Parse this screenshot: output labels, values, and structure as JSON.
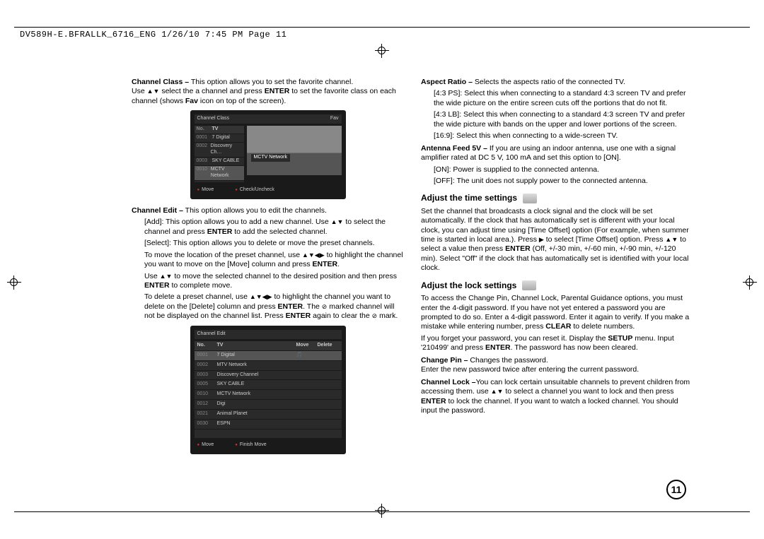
{
  "header": "DV589H-E.BFRALLK_6716_ENG  1/26/10  7:45 PM  Page 11",
  "page_number": "11",
  "left": {
    "channel_class_label": "Channel Class –",
    "channel_class_text": " This option allows you to set the favorite channel.",
    "channel_class_line2a": "Use ",
    "channel_class_line2b": " select the a channel and press ",
    "channel_class_enter": "ENTER",
    "channel_class_line2c": " to set the favorite class on each channel (shows ",
    "channel_class_fav": "Fav",
    "channel_class_line2d": " icon on top of the screen).",
    "shot1": {
      "title_left": "Channel Class",
      "title_right": "Fav",
      "col_no": "No.",
      "col_tv": "TV",
      "rows": [
        {
          "no": "0001",
          "name": "7 Digital"
        },
        {
          "no": "0002",
          "name": "Discovery Ch…"
        },
        {
          "no": "0003",
          "name": "SKY CABLE"
        },
        {
          "no": "0010",
          "name": "MCTV Network"
        }
      ],
      "preview_label": "MCTV Network",
      "foot_left": "Move",
      "foot_right": "Check/Uncheck"
    },
    "channel_edit_label": "Channel Edit –",
    "channel_edit_text": " This option allows you to edit the channels.",
    "add_line_a": "[Add]: This option allows you to add a new channel. Use ",
    "add_line_b": " to select the channel and press ",
    "add_line_c": " to add the selected channel.",
    "select_line": "[Select]: This option allows you to delete or move the preset channels.",
    "move_line_a": "To move the location of the preset channel, use ",
    "move_line_b": " to highlight the channel you want to move on the [Move] column and press ",
    "move_line_c": ".",
    "use_line_a": "Use ",
    "use_line_b": " to move the selected channel to the desired position and then press ",
    "use_line_c": " to complete move.",
    "delete_line_a": "To delete a preset channel, use ",
    "delete_line_b": " to highlight the channel you want to delete on the [Delete] column and press ",
    "delete_line_c": ". The ",
    "delete_line_d": " marked channel will not be displayed on the channel list. Press ",
    "delete_line_e": " again to clear the ",
    "delete_line_f": " mark.",
    "shot2": {
      "title": "Channel Edit",
      "h_no": "No.",
      "h_tv": "TV",
      "h_move": "Move",
      "h_del": "Delete",
      "rows": [
        {
          "no": "0001",
          "name": "7 Digital",
          "move": "🎵",
          "del": ""
        },
        {
          "no": "0002",
          "name": "MTV Network",
          "move": "",
          "del": ""
        },
        {
          "no": "0003",
          "name": "Discovery Channel",
          "move": "",
          "del": ""
        },
        {
          "no": "0005",
          "name": "SKY CABLE",
          "move": "",
          "del": ""
        },
        {
          "no": "0010",
          "name": "MCTV Network",
          "move": "",
          "del": ""
        },
        {
          "no": "0012",
          "name": "Digi",
          "move": "",
          "del": ""
        },
        {
          "no": "0021",
          "name": "Animal Planet",
          "move": "",
          "del": ""
        },
        {
          "no": "0030",
          "name": "ESPN",
          "move": "",
          "del": ""
        },
        {
          "no": "",
          "name": "",
          "move": "",
          "del": ""
        }
      ],
      "foot_left": "Move",
      "foot_right": "Finish Move"
    }
  },
  "right": {
    "aspect_label": "Aspect Ratio –",
    "aspect_text": " Selects the aspects ratio of the connected TV.",
    "ar_43ps": "[4:3 PS]: Select this when connecting to a standard 4:3 screen TV and prefer the wide picture on the entire screen cuts off the portions that do not fit.",
    "ar_43lb": "[4:3 LB]: Select this when connecting to a standard 4:3 screen TV and prefer the wide picture with bands on the upper and lower portions of the screen.",
    "ar_169": "[16:9]: Select this when connecting to a wide-screen TV.",
    "antenna_label": "Antenna Feed 5V –",
    "antenna_text": " If you are using an indoor antenna, use one with a signal amplifier rated at DC 5 V, 100 mA and set this option to [ON].",
    "antenna_on": "[ON]: Power is supplied to the connected antenna.",
    "antenna_off": "[OFF]: The unit does not supply power to the connected antenna.",
    "time_heading": "Adjust the time settings",
    "time_p_a": "Set the channel that broadcasts a clock signal and the clock will be set automatically. If the clock that has automatically set is different with your local clock, you can adjust time using [Time Offset] option (For example, when summer time is started in local area.). Press ",
    "time_p_b": " to select [Time Offset] option. Press ",
    "time_p_c": " to select a value then press ",
    "time_p_d": " (Off, +/-30 min, +/-60 min, +/-90 min, +/-120 min). Select \"Off\" if the clock that has automatically set is identified with your local clock.",
    "lock_heading": "Adjust the lock settings",
    "lock_p_a": "To access the Change Pin, Channel Lock, Parental Guidance options, you must enter the 4-digit password. If you have not yet entered a password you are prompted to do so. Enter a 4-digit password. Enter it again to verify. If you make a mistake while entering number, press ",
    "lock_clear": "CLEAR",
    "lock_p_b": " to delete numbers.",
    "lock_p2_a": "If you forget your password, you can reset it. Display the ",
    "lock_setup": "SETUP",
    "lock_p2_b": " menu. Input '210499' and press ",
    "lock_p2_c": ". The password has now been cleared.",
    "changepin_label": "Change Pin –",
    "changepin_text": " Changes the password.",
    "changepin_line2": "Enter the new password twice after entering the current password.",
    "chlock_label": "Channel Lock –",
    "chlock_a": "You can lock certain unsuitable channels to prevent children from accessing them. use ",
    "chlock_b": " to select a channel you want to lock and then press ",
    "chlock_c": " to lock the channel. If you want to watch a locked channel. You should input the password."
  }
}
